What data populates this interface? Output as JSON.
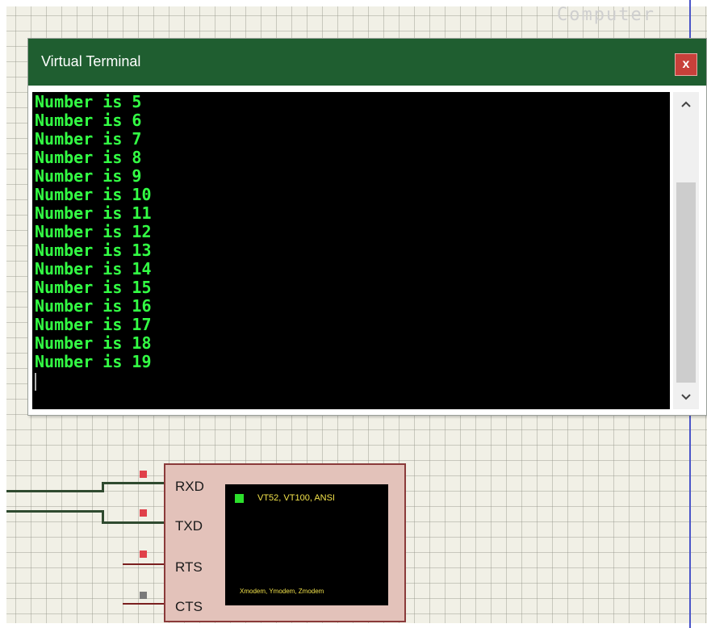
{
  "background": {
    "watermark": "Computer"
  },
  "terminal": {
    "title": "Virtual Terminal",
    "close_label": "x",
    "lines": [
      "Number is 5",
      "Number is 6",
      "Number is 7",
      "Number is 8",
      "Number is 9",
      "Number is 10",
      "Number is 11",
      "Number is 12",
      "Number is 13",
      "Number is 14",
      "Number is 15",
      "Number is 16",
      "Number is 17",
      "Number is 18",
      "Number is 19"
    ],
    "text_color": "#33ff44",
    "titlebar_color": "#1f5e30"
  },
  "component": {
    "pins": [
      "RXD",
      "TXD",
      "RTS",
      "CTS"
    ],
    "screen_title": "VT52, VT100, ANSI",
    "screen_footer": "Xmodem, Ymodem, Zmodem",
    "led_color": "#2ce02c"
  },
  "icons": {
    "scroll_up": "chevron-up-icon",
    "scroll_down": "chevron-down-icon",
    "close": "close-icon"
  }
}
